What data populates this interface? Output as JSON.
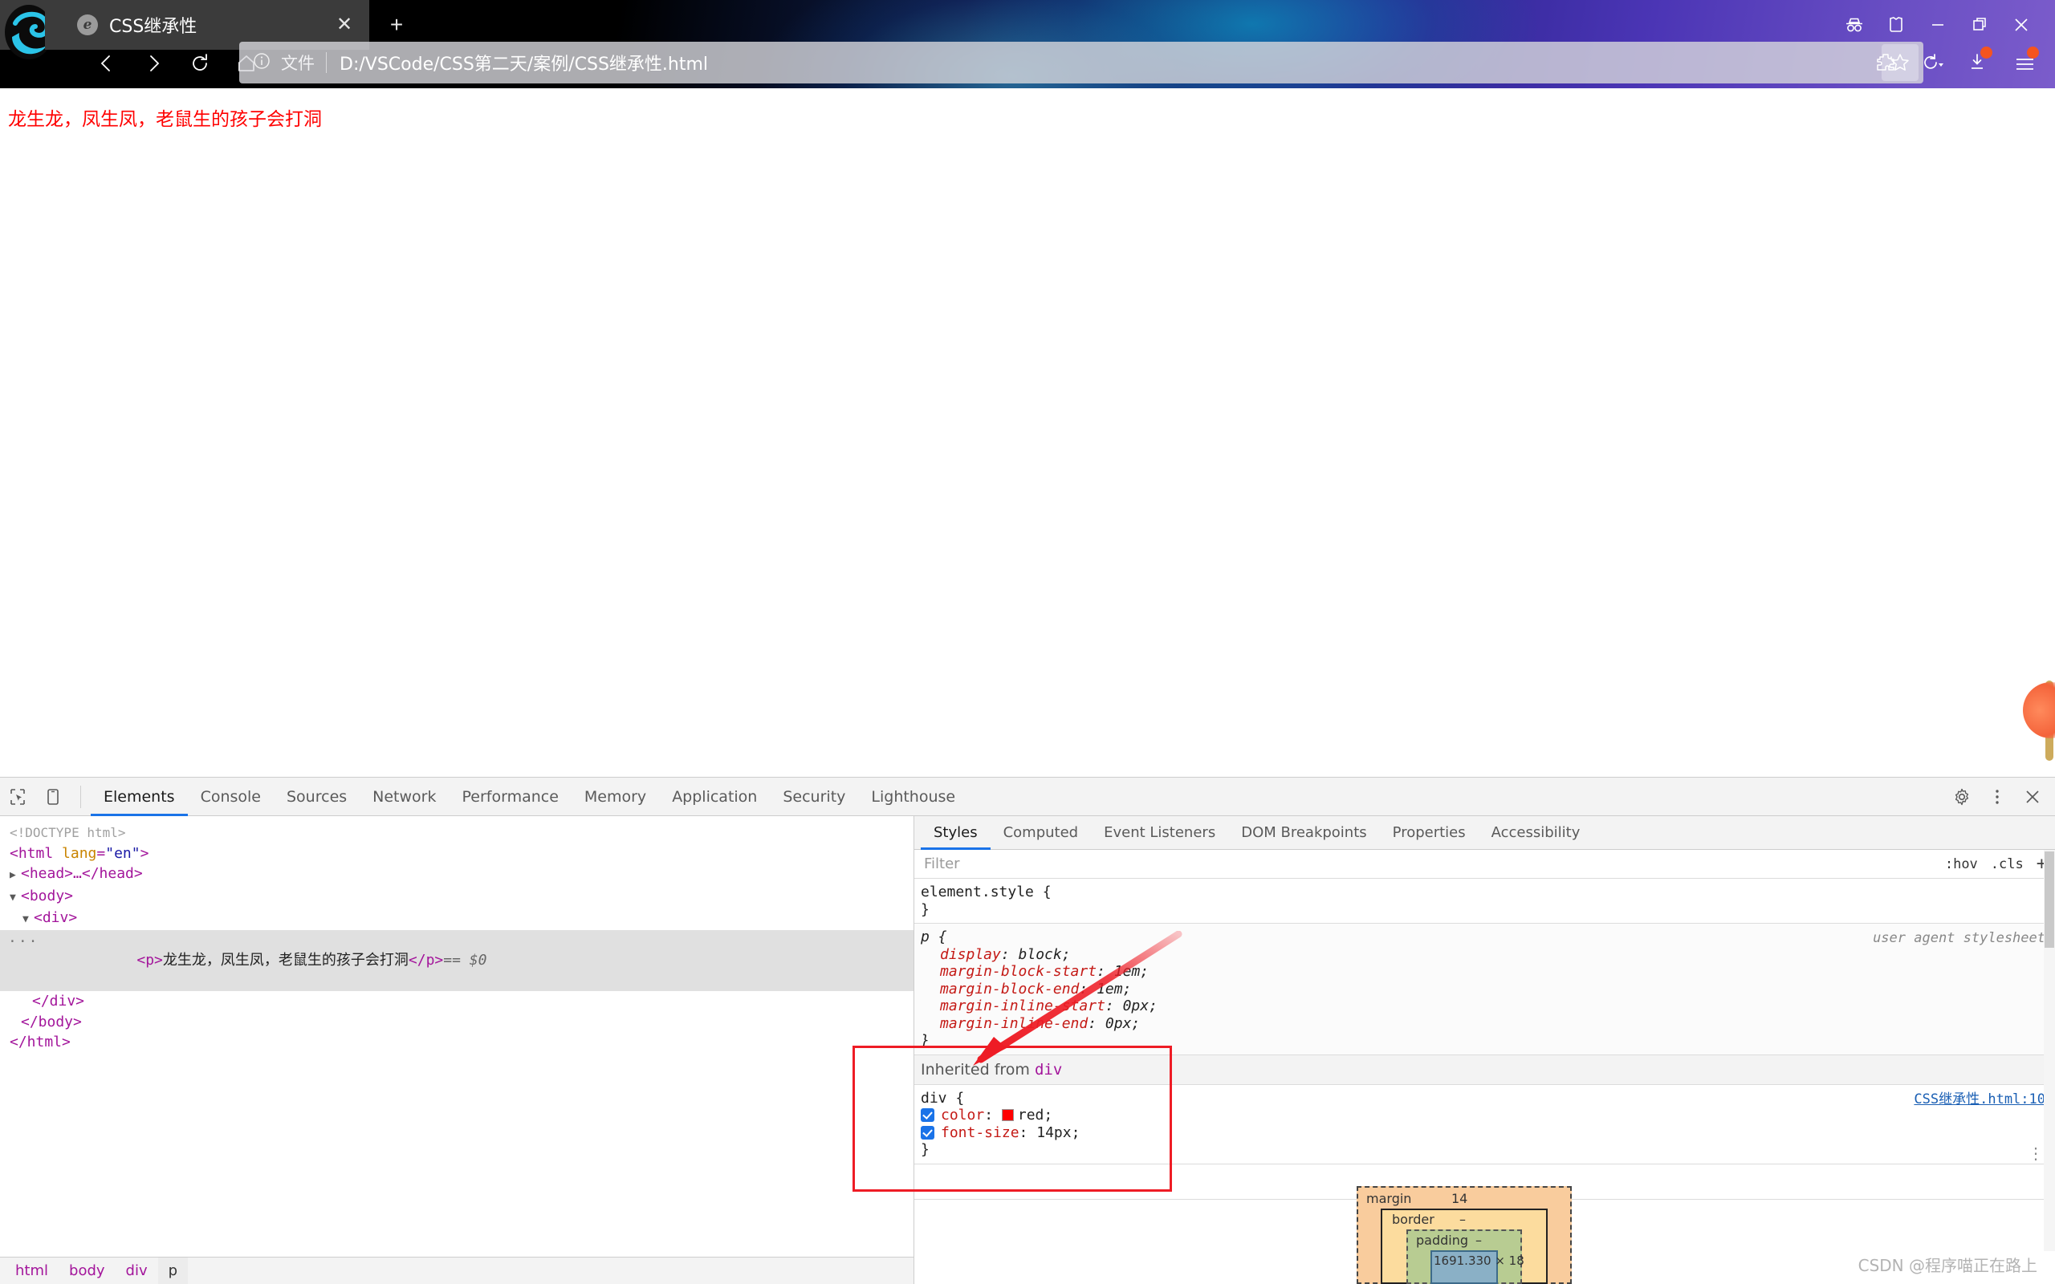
{
  "browser": {
    "tab": {
      "title": "CSS继承性",
      "favicon": "edge-favicon",
      "close_label": "✕"
    },
    "new_tab_label": "+",
    "nav": {
      "back": "‹",
      "forward": "›",
      "reload": "⟳",
      "home": "⌂"
    },
    "omnibox": {
      "file_label": "文件",
      "url": "D:/VSCode/CSS第二天/案例/CSS继承性.html",
      "info_icon": "info-icon",
      "star_icon": "star-icon"
    },
    "toolbar_right_icons": [
      "extensions-icon",
      "history-icon",
      "downloads-icon",
      "settings-menu-icon"
    ],
    "window_controls": [
      "inprivate-icon",
      "collections-icon",
      "minimize-icon",
      "restore-icon",
      "close-icon"
    ]
  },
  "page": {
    "paragraph": "龙生龙，凤生凤，老鼠生的孩子会打洞",
    "text_color": "#ff0000"
  },
  "devtools": {
    "panel_tabs": [
      "Elements",
      "Console",
      "Sources",
      "Network",
      "Performance",
      "Memory",
      "Application",
      "Security",
      "Lighthouse"
    ],
    "active_panel_tab": "Elements",
    "toolbar_icons": [
      "inspect-icon",
      "device-toolbar-icon",
      "settings-gear-icon",
      "more-options-icon",
      "close-devtools-icon"
    ],
    "dom": {
      "lines": [
        {
          "indent": 0,
          "type": "doctype",
          "text": "<!DOCTYPE html>"
        },
        {
          "indent": 0,
          "type": "open",
          "tag": "html",
          "attr": "lang",
          "value": "\"en\""
        },
        {
          "indent": 1,
          "type": "collapsed",
          "tag": "head",
          "triangle": "▶"
        },
        {
          "indent": 1,
          "type": "open",
          "tag": "body",
          "triangle": "▼"
        },
        {
          "indent": 2,
          "type": "open",
          "tag": "div",
          "triangle": "▼"
        },
        {
          "indent": 3,
          "type": "text-node",
          "tag": "p",
          "text": "龙生龙，凤生凤，老鼠生的孩子会打洞",
          "suffix": "== $0",
          "selected": true
        },
        {
          "indent": 2,
          "type": "close",
          "tag": "div"
        },
        {
          "indent": 1,
          "type": "close",
          "tag": "body"
        },
        {
          "indent": 0,
          "type": "close",
          "tag": "html"
        }
      ]
    },
    "breadcrumb": [
      "html",
      "body",
      "div",
      "p"
    ],
    "breadcrumb_active": "p",
    "styles": {
      "tabs": [
        "Styles",
        "Computed",
        "Event Listeners",
        "DOM Breakpoints",
        "Properties",
        "Accessibility"
      ],
      "active_tab": "Styles",
      "filter_placeholder": "Filter",
      "hov_label": ":hov",
      "cls_label": ".cls",
      "new_rule_label": "+",
      "rules": [
        {
          "selector": "element.style {",
          "close": "}",
          "declarations": [],
          "source": "",
          "ua": false
        },
        {
          "selector": "p {",
          "close": "}",
          "declarations": [
            {
              "prop": "display",
              "value": "block;"
            },
            {
              "prop": "margin-block-start",
              "value": "1em;"
            },
            {
              "prop": "margin-block-end",
              "value": "1em;"
            },
            {
              "prop": "margin-inline-start",
              "value": "0px;"
            },
            {
              "prop": "margin-inline-end",
              "value": "0px;"
            }
          ],
          "source": "user agent stylesheet",
          "ua": true
        }
      ],
      "inherited": {
        "header_prefix": "Inherited from",
        "header_tag": "div",
        "selector": "div {",
        "close": "}",
        "source_link": "CSS继承性.html:10",
        "declarations": [
          {
            "prop": "color",
            "value": "red;",
            "checked": true,
            "swatch": "#ff0000"
          },
          {
            "prop": "font-size",
            "value": "14px;",
            "checked": true,
            "swatch": null
          }
        ]
      }
    },
    "box_model": {
      "margin_label": "margin",
      "margin_value": "14",
      "border_label": "border",
      "border_value": "–",
      "padding_label": "padding",
      "padding_value": "–",
      "content_size": "1691.330 × 18"
    }
  },
  "watermark": "CSDN @程序喵正在路上"
}
